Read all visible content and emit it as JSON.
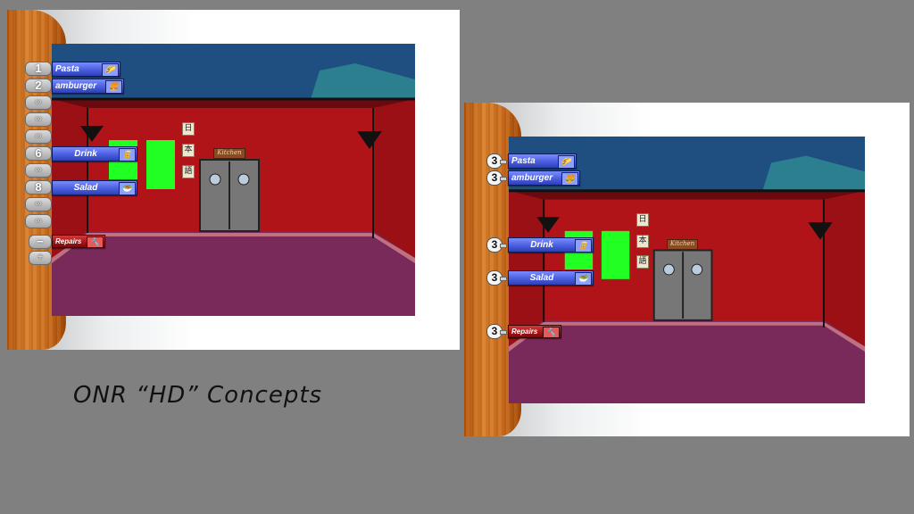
{
  "caption": "ONR “HD” Concepts",
  "scene": {
    "door_sign": "Kitchen",
    "kanji": [
      "日",
      "本",
      "語"
    ]
  },
  "panel_a": {
    "menu": [
      {
        "key": "1",
        "label": "Pasta",
        "icon": "taco-icon"
      },
      {
        "key": "2",
        "label": "amburger",
        "icon": "burger-icon"
      },
      {
        "key": "6",
        "label": "Drink",
        "icon": "soda-can-icon"
      },
      {
        "key": "8",
        "label": "Salad",
        "icon": "salad-bowl-icon"
      },
      {
        "key": "−",
        "label": "Repairs",
        "icon": "wrench-icon"
      }
    ]
  },
  "panel_b": {
    "menu": [
      {
        "badge": "3",
        "label": "Pasta",
        "icon": "taco-icon"
      },
      {
        "badge": "3",
        "label": "amburger",
        "icon": "burger-icon"
      },
      {
        "badge": "3",
        "label": "Drink",
        "icon": "soda-can-icon"
      },
      {
        "badge": "3",
        "label": "Salad",
        "icon": "salad-bowl-icon"
      },
      {
        "badge": "3",
        "label": "Repairs",
        "icon": "wrench-icon"
      }
    ]
  },
  "colors": {
    "background": "#808080",
    "wall": "#b01418",
    "floor": "#7a2a5a",
    "ceiling": "#1f4f80",
    "button_blue": "#4a5fe0",
    "button_red": "#a21414",
    "green_screen": "#22ff22"
  }
}
